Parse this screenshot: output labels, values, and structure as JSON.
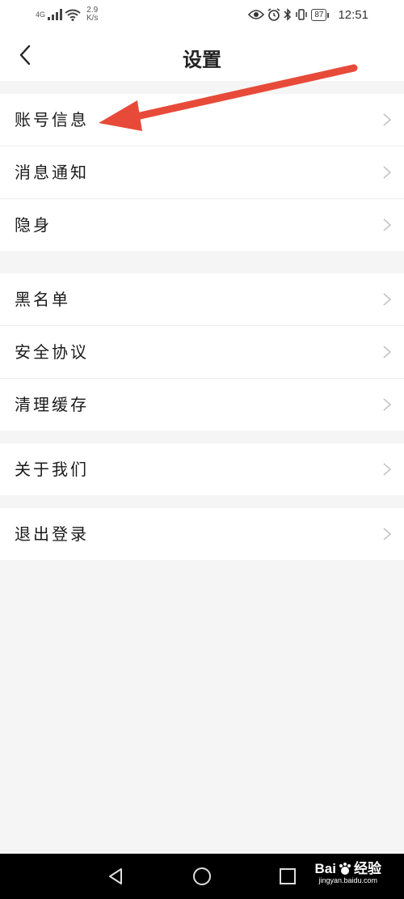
{
  "status_bar": {
    "network": "4G",
    "speed_value": "2.9",
    "speed_unit": "K/s",
    "battery": "87",
    "time": "12:51"
  },
  "header": {
    "title": "设置",
    "back_icon": "chevron-left-icon"
  },
  "groups": [
    {
      "items": [
        {
          "label": "账号信息"
        },
        {
          "label": "消息通知"
        },
        {
          "label": "隐身"
        }
      ]
    },
    {
      "items": [
        {
          "label": "黑名单"
        },
        {
          "label": "安全协议"
        },
        {
          "label": "清理缓存"
        }
      ]
    },
    {
      "items": [
        {
          "label": "关于我们"
        }
      ]
    },
    {
      "items": [
        {
          "label": "退出登录"
        }
      ]
    }
  ],
  "annotation": {
    "color": "#e84a3a",
    "icon": "red-arrow"
  },
  "nav_bar": {
    "icons": [
      "back-triangle-icon",
      "home-circle-icon",
      "recents-square-icon"
    ]
  },
  "watermark": {
    "brand": "Bai",
    "brand2": "经验",
    "url": "jingyan.baidu.com"
  }
}
